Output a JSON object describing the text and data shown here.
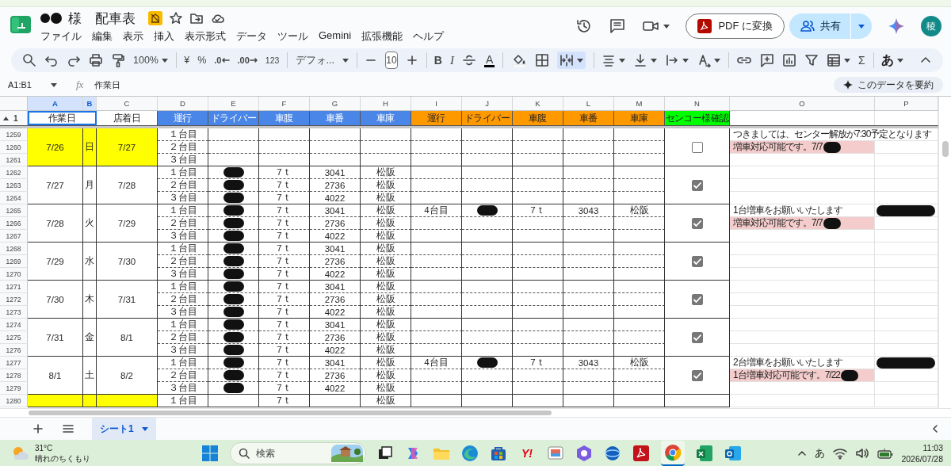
{
  "window": {
    "title": "様　配車表",
    "title_redacted": true
  },
  "menu": [
    "ファイル",
    "編集",
    "表示",
    "挿入",
    "表示形式",
    "データ",
    "ツール",
    "Gemini",
    "拡張機能",
    "ヘルプ"
  ],
  "header_actions": {
    "pdf_button": "PDF に変換",
    "share_button": "共有",
    "avatar": "稜"
  },
  "toolbar": {
    "zoom": "100%",
    "currency": "¥",
    "percent": "%",
    "decrease_decimals": ".0",
    "increase_decimals": ".00",
    "number_format": "123",
    "font": "デフォ...",
    "font_size": "10",
    "bold": "B",
    "italic": "I",
    "text_color": "A",
    "sum": "Σ",
    "input_tools": "あ",
    "merge_active": true
  },
  "formula_bar": {
    "cell_ref": "A1:B1",
    "fx": "fx",
    "content": "作業日",
    "summarize_button": "このデータを要約"
  },
  "sheet": {
    "column_headers": [
      {
        "label": "A",
        "selected": true
      },
      {
        "label": "B",
        "selected": true
      },
      {
        "label": "C",
        "selected": false
      },
      {
        "label": "D",
        "selected": false
      },
      {
        "label": "E",
        "selected": false
      },
      {
        "label": "F",
        "selected": false
      },
      {
        "label": "G",
        "selected": false
      },
      {
        "label": "H",
        "selected": false
      },
      {
        "label": "I",
        "selected": false
      },
      {
        "label": "J",
        "selected": false
      },
      {
        "label": "K",
        "selected": false
      },
      {
        "label": "L",
        "selected": false
      },
      {
        "label": "M",
        "selected": false
      },
      {
        "label": "N",
        "selected": false
      },
      {
        "label": "O",
        "selected": false
      },
      {
        "label": "P",
        "selected": false
      }
    ],
    "header_row": {
      "number": "1",
      "cells": [
        {
          "text": "作業日",
          "merged": true,
          "selected": true,
          "color": "#ffffff"
        },
        {
          "text": "店着日",
          "merged": false,
          "selected": false,
          "color": "#ffffff"
        },
        {
          "text": "運行",
          "merged": false,
          "selected": false,
          "color": "#4a86e8"
        },
        {
          "text": "ドライバー",
          "merged": false,
          "selected": false,
          "color": "#4a86e8"
        },
        {
          "text": "車腹",
          "merged": false,
          "selected": false,
          "color": "#4a86e8"
        },
        {
          "text": "車番",
          "merged": false,
          "selected": false,
          "color": "#4a86e8"
        },
        {
          "text": "車庫",
          "merged": false,
          "selected": false,
          "color": "#4a86e8"
        },
        {
          "text": "運行",
          "merged": false,
          "selected": false,
          "color": "#ff9900"
        },
        {
          "text": "ドライバー",
          "merged": false,
          "selected": false,
          "color": "#ff9900"
        },
        {
          "text": "車腹",
          "merged": false,
          "selected": false,
          "color": "#ff9900"
        },
        {
          "text": "車番",
          "merged": false,
          "selected": false,
          "color": "#ff9900"
        },
        {
          "text": "車庫",
          "merged": false,
          "selected": false,
          "color": "#ff9900"
        },
        {
          "text": "センコー様確認",
          "merged": false,
          "selected": false,
          "color": "#00ff00"
        }
      ]
    },
    "days": [
      {
        "work_date": "7/26",
        "weekday": "日",
        "arrival_date": "7/27",
        "highlight": true,
        "confirmed": false,
        "trips": [
          {
            "row": "1259",
            "run": "１台目",
            "driver_redacted": false,
            "note": {
              "text": "つきましては、センター解放が7:30予定となります",
              "highlighted": false,
              "redacted": false
            }
          },
          {
            "row": "1260",
            "run": "２台目",
            "driver_redacted": false,
            "note": {
              "text": "増車対応可能です。7/7",
              "highlighted": true,
              "redacted": true
            }
          },
          {
            "row": "1261",
            "run": "３台目",
            "driver_redacted": false
          }
        ]
      },
      {
        "work_date": "7/27",
        "weekday": "月",
        "arrival_date": "7/28",
        "highlight": false,
        "confirmed": true,
        "trips": [
          {
            "row": "1262",
            "run": "１台目",
            "driver_redacted": true,
            "size": "7ｔ",
            "number": "3041",
            "depot": "松阪"
          },
          {
            "row": "1263",
            "run": "２台目",
            "driver_redacted": true,
            "size": "7ｔ",
            "number": "2736",
            "depot": "松阪"
          },
          {
            "row": "1264",
            "run": "３台目",
            "driver_redacted": true,
            "size": "7ｔ",
            "number": "4022",
            "depot": "松阪"
          }
        ]
      },
      {
        "work_date": "7/28",
        "weekday": "火",
        "arrival_date": "7/29",
        "highlight": false,
        "confirmed": true,
        "trips": [
          {
            "row": "1265",
            "run": "１台目",
            "driver_redacted": true,
            "size": "7ｔ",
            "number": "3041",
            "depot": "松阪",
            "extra": {
              "run": "4台目",
              "driver_redacted": true,
              "size": "7ｔ",
              "number": "3043",
              "depot": "松阪"
            },
            "note": {
              "text": "1台増車をお願いいたします",
              "highlighted": false,
              "redacted": false
            },
            "p_redacted": true
          },
          {
            "row": "1266",
            "run": "２台目",
            "driver_redacted": true,
            "size": "7ｔ",
            "number": "2736",
            "depot": "松阪",
            "note": {
              "text": "増車対応可能です。7/7",
              "highlighted": true,
              "redacted": true
            }
          },
          {
            "row": "1267",
            "run": "３台目",
            "driver_redacted": true,
            "size": "7ｔ",
            "number": "4022",
            "depot": "松阪"
          }
        ]
      },
      {
        "work_date": "7/29",
        "weekday": "水",
        "arrival_date": "7/30",
        "highlight": false,
        "confirmed": true,
        "trips": [
          {
            "row": "1268",
            "run": "１台目",
            "driver_redacted": true,
            "size": "7ｔ",
            "number": "3041",
            "depot": "松阪"
          },
          {
            "row": "1269",
            "run": "２台目",
            "driver_redacted": true,
            "size": "7ｔ",
            "number": "2736",
            "depot": "松阪"
          },
          {
            "row": "1270",
            "run": "３台目",
            "driver_redacted": true,
            "size": "7ｔ",
            "number": "4022",
            "depot": "松阪"
          }
        ]
      },
      {
        "work_date": "7/30",
        "weekday": "木",
        "arrival_date": "7/31",
        "highlight": false,
        "confirmed": true,
        "trips": [
          {
            "row": "1271",
            "run": "１台目",
            "driver_redacted": true,
            "size": "7ｔ",
            "number": "3041",
            "depot": "松阪"
          },
          {
            "row": "1272",
            "run": "２台目",
            "driver_redacted": true,
            "size": "7ｔ",
            "number": "2736",
            "depot": "松阪"
          },
          {
            "row": "1273",
            "run": "３台目",
            "driver_redacted": true,
            "size": "7ｔ",
            "number": "4022",
            "depot": "松阪"
          }
        ]
      },
      {
        "work_date": "7/31",
        "weekday": "金",
        "arrival_date": "8/1",
        "highlight": false,
        "confirmed": true,
        "trips": [
          {
            "row": "1274",
            "run": "１台目",
            "driver_redacted": true,
            "size": "7ｔ",
            "number": "3041",
            "depot": "松阪"
          },
          {
            "row": "1275",
            "run": "２台目",
            "driver_redacted": true,
            "size": "7ｔ",
            "number": "2736",
            "depot": "松阪"
          },
          {
            "row": "1276",
            "run": "３台目",
            "driver_redacted": true,
            "size": "7ｔ",
            "number": "4022",
            "depot": "松阪"
          }
        ]
      },
      {
        "work_date": "8/1",
        "weekday": "土",
        "arrival_date": "8/2",
        "highlight": false,
        "confirmed": true,
        "trips": [
          {
            "row": "1277",
            "run": "１台目",
            "driver_redacted": true,
            "size": "7ｔ",
            "number": "3041",
            "depot": "松阪",
            "extra": {
              "run": "4台目",
              "driver_redacted": true,
              "size": "7ｔ",
              "number": "3043",
              "depot": "松阪"
            },
            "note": {
              "text": "2台増車をお願いいたします",
              "highlighted": false,
              "redacted": false
            },
            "p_redacted": true
          },
          {
            "row": "1278",
            "run": "２台目",
            "driver_redacted": true,
            "size": "7ｔ",
            "number": "2736",
            "depot": "松阪",
            "note": {
              "text": "1台増車対応可能です。7/22",
              "highlighted": true,
              "redacted": true
            }
          },
          {
            "row": "1279",
            "run": "３台目",
            "driver_redacted": true,
            "size": "7ｔ",
            "number": "4022",
            "depot": "松阪"
          }
        ]
      },
      {
        "highlight": true,
        "trips": [
          {
            "row": "1280",
            "run": "１台目",
            "driver_redacted": false,
            "size": "7ｔ",
            "depot": "松阪"
          }
        ]
      }
    ]
  },
  "sheet_tabs": [
    {
      "label": "シート1",
      "selected": true
    }
  ],
  "taskbar": {
    "temperature": "31°C",
    "weather": "晴れのちくもり",
    "search_placeholder": "検索",
    "yahoo_label": "Y!",
    "ime": "あ",
    "time": "11:03",
    "date": "2026/07/28"
  }
}
